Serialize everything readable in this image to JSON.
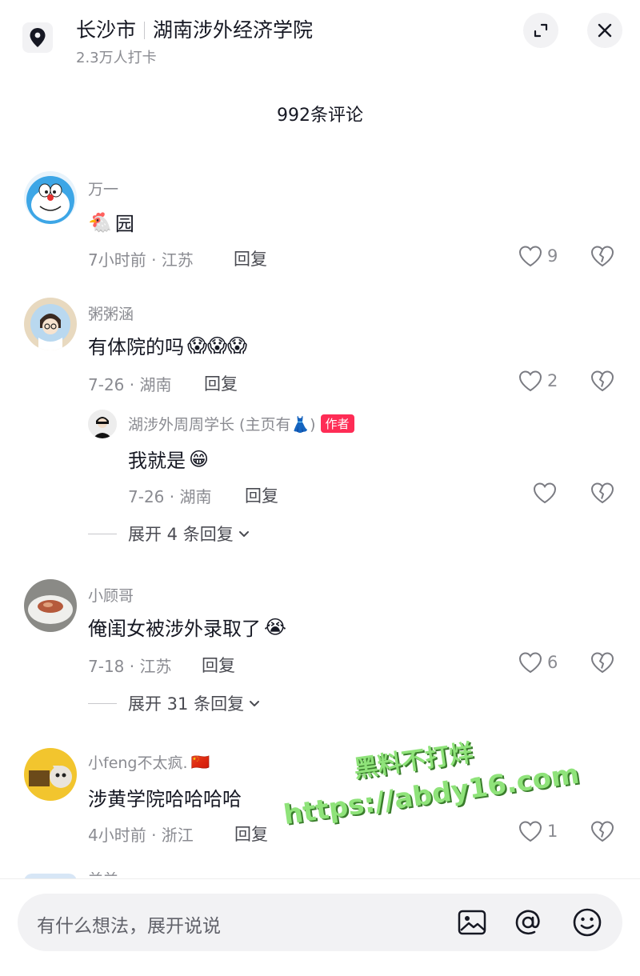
{
  "header": {
    "city": "长沙市",
    "place": "湖南涉外经济学院",
    "checkins": "2.3万人打卡",
    "icons": {
      "location": "map-pin-icon",
      "expand": "expand-icon",
      "close": "close-icon"
    }
  },
  "comments_title": "992条评论",
  "comments": [
    {
      "username": "万一",
      "text": "园",
      "emoji": "🐔",
      "time": "7小时前 · 江苏",
      "reply_label": "回复",
      "likes": "9"
    },
    {
      "username": "粥粥涵",
      "text": "有体院的吗",
      "emoji": "😱😱😱",
      "time": "7-26 · 湖南",
      "reply_label": "回复",
      "likes": "2",
      "reply": {
        "username": "湖涉外周周学长 (主页有👗)",
        "badge": "作者",
        "text": "我就是",
        "emoji": "😁",
        "time": "7-26 · 湖南",
        "reply_label": "回复"
      },
      "expand": "展开 4 条回复"
    },
    {
      "username": "小顾哥",
      "text": "俺闺女被涉外录取了",
      "emoji": "😭",
      "time": "7-18 · 江苏",
      "reply_label": "回复",
      "likes": "6",
      "expand": "展开 31 条回复"
    },
    {
      "username": "小feng不太疯.",
      "flag": "🇨🇳",
      "text": "涉黄学院哈哈哈哈",
      "time": "4小时前 · 浙江",
      "reply_label": "回复",
      "likes": "1"
    }
  ],
  "next_username_peek": "兰兰",
  "watermark": {
    "line1": "黑料不打烊",
    "line2": "https://abdy16.com"
  },
  "input": {
    "placeholder": "有什么想法，展开说说",
    "icons": [
      "image-icon",
      "at-icon",
      "emoji-icon"
    ]
  },
  "colors": {
    "text": "#161823",
    "secondary": "#8a8b91",
    "author_badge": "#fe2c55",
    "watermark": "#8fe37a"
  }
}
